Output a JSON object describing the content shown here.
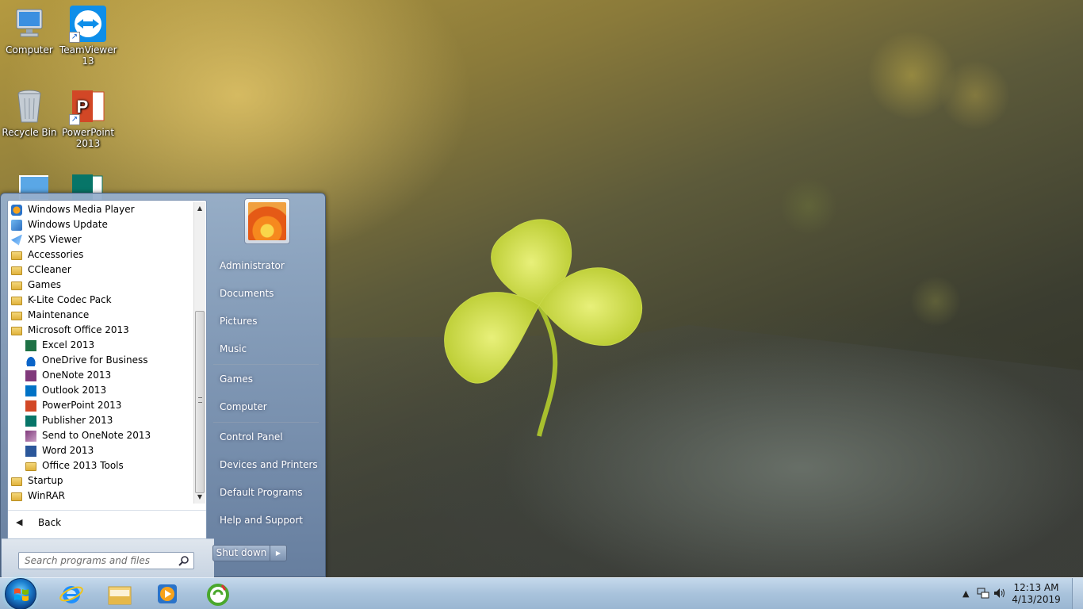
{
  "desktop": {
    "icons": [
      {
        "label": "Computer",
        "icon": "computer-icon"
      },
      {
        "label": "TeamViewer 13",
        "icon": "teamviewer-icon"
      },
      {
        "label": "Recycle Bin",
        "icon": "recycle-bin-icon"
      },
      {
        "label": "PowerPoint 2013",
        "icon": "powerpoint-icon"
      }
    ]
  },
  "start_menu": {
    "programs": [
      {
        "label": "Windows Media Player",
        "icon": "media-player-icon",
        "level": 0
      },
      {
        "label": "Windows Update",
        "icon": "windows-update-icon",
        "level": 0
      },
      {
        "label": "XPS Viewer",
        "icon": "xps-viewer-icon",
        "level": 0
      },
      {
        "label": "Accessories",
        "icon": "folder-icon",
        "level": 0
      },
      {
        "label": "CCleaner",
        "icon": "folder-icon",
        "level": 0
      },
      {
        "label": "Games",
        "icon": "folder-icon",
        "level": 0
      },
      {
        "label": "K-Lite Codec Pack",
        "icon": "folder-icon",
        "level": 0
      },
      {
        "label": "Maintenance",
        "icon": "folder-icon",
        "level": 0
      },
      {
        "label": "Microsoft Office 2013",
        "icon": "folder-icon",
        "level": 0
      },
      {
        "label": "Excel 2013",
        "icon": "excel-icon",
        "level": 1
      },
      {
        "label": "OneDrive for Business",
        "icon": "onedrive-icon",
        "level": 1
      },
      {
        "label": "OneNote 2013",
        "icon": "onenote-icon",
        "level": 1
      },
      {
        "label": "Outlook 2013",
        "icon": "outlook-icon",
        "level": 1
      },
      {
        "label": "PowerPoint 2013",
        "icon": "powerpoint-icon",
        "level": 1
      },
      {
        "label": "Publisher 2013",
        "icon": "publisher-icon",
        "level": 1
      },
      {
        "label": "Send to OneNote 2013",
        "icon": "send-to-onenote-icon",
        "level": 1
      },
      {
        "label": "Word 2013",
        "icon": "word-icon",
        "level": 1
      },
      {
        "label": "Office 2013 Tools",
        "icon": "folder-icon",
        "level": 1
      },
      {
        "label": "Startup",
        "icon": "folder-icon",
        "level": 0
      },
      {
        "label": "WinRAR",
        "icon": "folder-icon",
        "level": 0
      }
    ],
    "back_label": "Back",
    "search_placeholder": "Search programs and files",
    "right_items": {
      "administrator": "Administrator",
      "documents": "Documents",
      "pictures": "Pictures",
      "music": "Music",
      "games": "Games",
      "computer": "Computer",
      "control_panel": "Control Panel",
      "devices_printers": "Devices and Printers",
      "default_programs": "Default Programs",
      "help_support": "Help and Support"
    },
    "shutdown_label": "Shut down"
  },
  "taskbar": {
    "pinned": [
      {
        "icon": "internet-explorer-icon"
      },
      {
        "icon": "file-explorer-icon"
      },
      {
        "icon": "media-player-icon"
      },
      {
        "icon": "ccleaner-icon"
      }
    ],
    "clock": {
      "time": "12:13 AM",
      "date": "4/13/2019"
    }
  },
  "colors": {
    "taskbar": "#a9c3dc",
    "start_menu_right": "#8aa3c3",
    "excel": "#1e7145",
    "word": "#2b579a",
    "powerpoint": "#d24726",
    "outlook": "#0072c6",
    "onenote": "#80397b",
    "publisher": "#077568"
  }
}
